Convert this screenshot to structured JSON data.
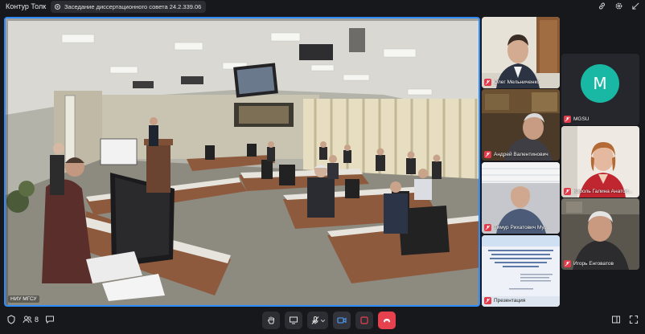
{
  "app": {
    "title": "Контур Толк"
  },
  "meeting": {
    "title": "Заседание диссертационного совета 24.2.339.06"
  },
  "main_video": {
    "label": "НИУ МГСУ"
  },
  "participants": [
    {
      "name": "Олег Мельниченко",
      "muted": true
    },
    {
      "name": "MGSU",
      "avatar_letter": "M",
      "avatar_color": "#19b8a4",
      "muted": true
    },
    {
      "name": "Андрей Валентинович",
      "muted": true
    },
    {
      "name": "Король Галина Анатол...",
      "muted": true
    },
    {
      "name": "Тимур Рихатович Му...",
      "muted": true
    },
    {
      "name": "Игорь Енговатов",
      "muted": true
    },
    {
      "name": "Презентация",
      "muted": true
    }
  ],
  "toolbar": {
    "participant_count": "8"
  },
  "colors": {
    "accent": "#2f8cff",
    "danger": "#e5414f",
    "avatar": "#19b8a4"
  },
  "icons": [
    "shield-icon",
    "participants-icon",
    "chat-icon",
    "hand-icon",
    "screen-share-icon",
    "microphone-icon",
    "chevron-down-icon",
    "camera-icon",
    "record-icon",
    "hang-up-icon",
    "link-icon",
    "settings-icon",
    "minimize-icon",
    "layout-icon",
    "fullscreen-icon"
  ]
}
